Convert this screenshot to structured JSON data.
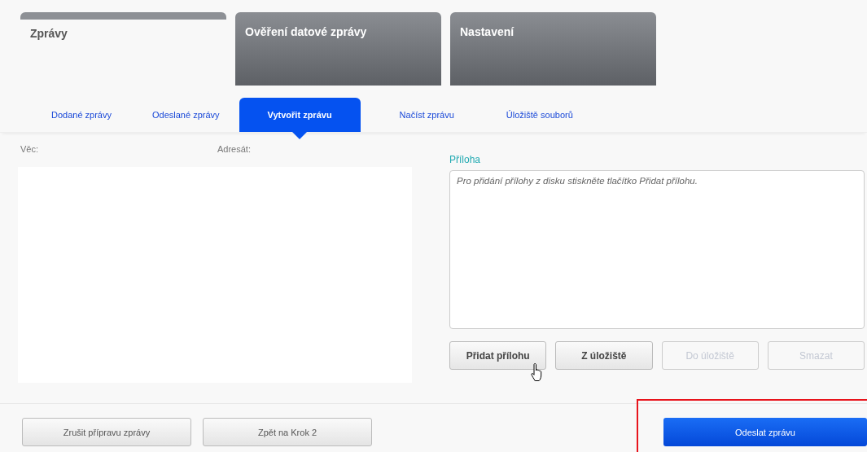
{
  "main_tabs": [
    {
      "label": "Zprávy",
      "selected": true
    },
    {
      "label": "Ověření datové zprávy",
      "selected": false
    },
    {
      "label": "Nastavení",
      "selected": false
    }
  ],
  "sub_tabs": [
    {
      "label": "Dodané zprávy",
      "selected": false
    },
    {
      "label": "Odeslané zprávy",
      "selected": false
    },
    {
      "label": "Vytvořit zprávu",
      "selected": true
    },
    {
      "label": "Načíst zprávu",
      "selected": false
    },
    {
      "label": "Úložiště souborů",
      "selected": false
    }
  ],
  "message": {
    "subject_label": "Věc:",
    "recipient_label": "Adresát:"
  },
  "attachment": {
    "label": "Příloha",
    "placeholder": "Pro přidání přílohy z disku stiskněte tlačítko Přidat přílohu."
  },
  "attachment_buttons": [
    {
      "label": "Přidat přílohu",
      "disabled": false
    },
    {
      "label": "Z úložiště",
      "disabled": false
    },
    {
      "label": "Do úložiště",
      "disabled": true
    },
    {
      "label": "Smazat",
      "disabled": true
    }
  ],
  "footer_buttons": [
    {
      "label": "Zrušit přípravu zprávy",
      "kind": "secondary"
    },
    {
      "label": "Zpět na Krok 2",
      "kind": "secondary"
    },
    {
      "label": "Odeslat zprávu",
      "kind": "primary",
      "highlighted": true
    }
  ]
}
